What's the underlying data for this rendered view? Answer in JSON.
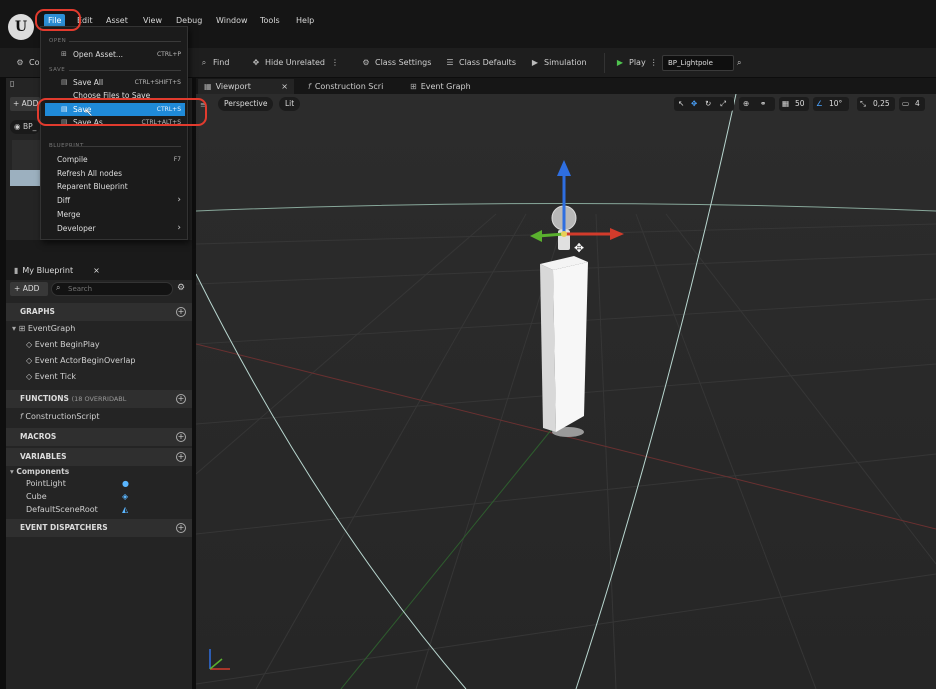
{
  "menubar": {
    "logo": "U",
    "items": [
      "File",
      "Edit",
      "Asset",
      "View",
      "Debug",
      "Window",
      "Tools",
      "Help"
    ]
  },
  "toolbar": {
    "compile_label": "Co",
    "find_label": "Find",
    "hide_unrelated_label": "Hide Unrelated",
    "class_settings_label": "Class Settings",
    "class_defaults_label": "Class Defaults",
    "simulation_label": "Simulation",
    "play_label": "Play",
    "blueprint_select": "BP_Lightpole"
  },
  "tabs": [
    "Viewport",
    "Construction Scri",
    "Event Graph"
  ],
  "viewport": {
    "view_mode": "Perspective",
    "lit_mode": "Lit",
    "grid_snap": "50",
    "rotation_snap": "10°",
    "scale_snap": "0,25",
    "camera_speed": "4"
  },
  "file_menu": {
    "open_header": "OPEN",
    "open_asset": "Open Asset...",
    "open_asset_sc": "CTRL+P",
    "save_header": "SAVE",
    "save_all": "Save All",
    "save_all_sc": "CTRL+SHIFT+S",
    "choose_files": "Choose Files to Save",
    "save": "Save",
    "save_sc": "CTRL+S",
    "save_as": "Save As",
    "save_as_sc": "CTRL+ALT+S",
    "blueprint_header": "BLUEPRINT",
    "compile": "Compile",
    "compile_sc": "F7",
    "refresh_nodes": "Refresh All nodes",
    "reparent": "Reparent Blueprint",
    "diff": "Diff",
    "merge": "Merge",
    "developer": "Developer"
  },
  "components_panel": {
    "add_label": "+ ADD",
    "bp_label": "BP_"
  },
  "my_blueprint": {
    "title": "My Blueprint",
    "add_label": "ADD",
    "search_placeholder": "Search",
    "graphs_header": "GRAPHS",
    "event_graph": "EventGraph",
    "events": [
      "Event BeginPlay",
      "Event ActorBeginOverlap",
      "Event Tick"
    ],
    "functions_header": "FUNCTIONS",
    "functions_note": "(18 OVERRIDABL",
    "construction_script": "ConstructionScript",
    "macros_header": "MACROS",
    "variables_header": "VARIABLES",
    "components_label": "Components",
    "components": [
      "PointLight",
      "Cube",
      "DefaultSceneRoot"
    ],
    "dispatchers_header": "EVENT DISPATCHERS"
  }
}
